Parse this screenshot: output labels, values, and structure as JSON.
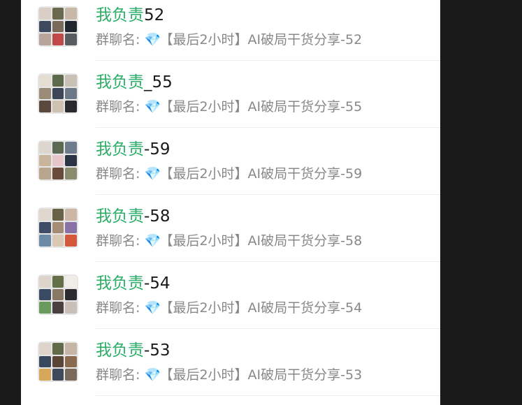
{
  "chats": [
    {
      "highlight": "我负责",
      "suffix": "52",
      "label": "群聊名:",
      "gem": "💎",
      "group": "【最后2小时】AI破局干货分享-52"
    },
    {
      "highlight": "我负责",
      "suffix": "_55",
      "label": "群聊名:",
      "gem": "💎",
      "group": "【最后2小时】AI破局干货分享-55"
    },
    {
      "highlight": "我负责",
      "suffix": "-59",
      "label": "群聊名:",
      "gem": "💎",
      "group": "【最后2小时】AI破局干货分享-59"
    },
    {
      "highlight": "我负责",
      "suffix": "-58",
      "label": "群聊名:",
      "gem": "💎",
      "group": "【最后2小时】AI破局干货分享-58"
    },
    {
      "highlight": "我负责",
      "suffix": "-54",
      "label": "群聊名:",
      "gem": "💎",
      "group": "【最后2小时】AI破局干货分享-54"
    },
    {
      "highlight": "我负责",
      "suffix": "-53",
      "label": "群聊名:",
      "gem": "💎",
      "group": "【最后2小时】AI破局干货分享-53"
    }
  ],
  "colors": {
    "highlight": "#2aae67",
    "text": "#191919",
    "subtext": "#888888",
    "gem": "#3ba6f2"
  },
  "icons": {
    "avatar": "group-avatar-grid-icon",
    "gem": "gem-icon"
  }
}
